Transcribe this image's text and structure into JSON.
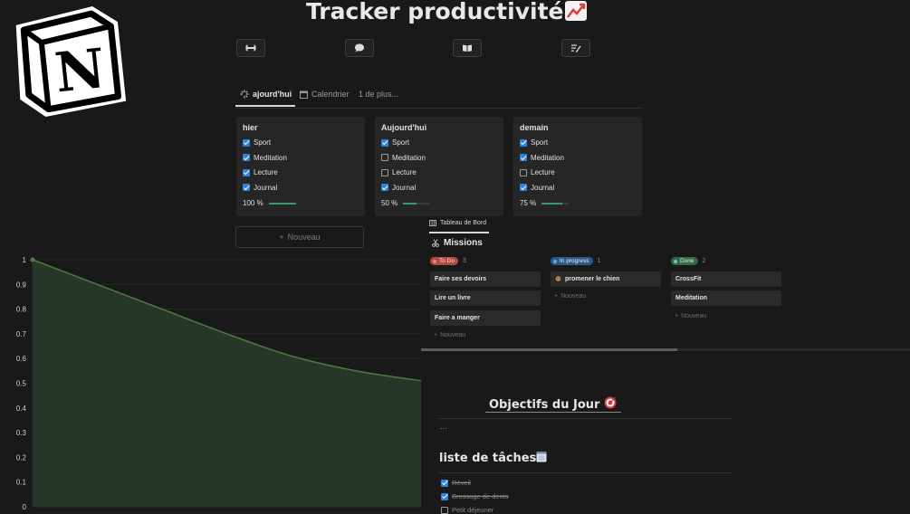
{
  "page": {
    "title": "Tracker productivité",
    "title_emoji": "chart-increasing-icon"
  },
  "toolbar_icons": [
    "dumbbell-icon",
    "speech-bubble-icon",
    "open-book-icon",
    "notepad-icon"
  ],
  "views": {
    "tabs": [
      {
        "label": "ajourd'hui",
        "icon": "sparkle-icon",
        "active": true
      },
      {
        "label": "Calendrier",
        "icon": "calendar-icon",
        "active": false
      },
      {
        "label": "1 de plus...",
        "icon": "",
        "active": false
      }
    ]
  },
  "days": [
    {
      "title": "hier",
      "items": [
        {
          "label": "Sport",
          "checked": true
        },
        {
          "label": "Meditation",
          "checked": true
        },
        {
          "label": "Lecture",
          "checked": true
        },
        {
          "label": "Journal",
          "checked": true
        }
      ],
      "progress_label": "100 %",
      "progress": 1.0
    },
    {
      "title": "Aujourd'hui",
      "items": [
        {
          "label": "Sport",
          "checked": true
        },
        {
          "label": "Meditation",
          "checked": false
        },
        {
          "label": "Lecture",
          "checked": false
        },
        {
          "label": "Journal",
          "checked": true
        }
      ],
      "progress_label": "50 %",
      "progress": 0.5
    },
    {
      "title": "demain",
      "items": [
        {
          "label": "Sport",
          "checked": true
        },
        {
          "label": "Meditation",
          "checked": true
        },
        {
          "label": "Lecture",
          "checked": false
        },
        {
          "label": "Journal",
          "checked": true
        }
      ],
      "progress_label": "75 %",
      "progress": 0.75
    }
  ],
  "new_button": {
    "label": "Nouveau"
  },
  "chart_data": {
    "type": "area",
    "x": [
      0,
      1,
      2,
      3,
      4,
      5,
      6
    ],
    "values": [
      1.0,
      0.9,
      0.8,
      0.7,
      0.61,
      0.55,
      0.51
    ],
    "yticks": [
      "0",
      "0.1",
      "0.2",
      "0.3",
      "0.4",
      "0.5",
      "0.6",
      "0.7",
      "0.8",
      "0.9",
      "1"
    ],
    "ylim": [
      0,
      1
    ],
    "title": "",
    "xlabel": "",
    "ylabel": "",
    "fill_color": "#26372a",
    "line_color": "#4f7a45"
  },
  "kanban": {
    "view_tab": "Tableau de Bord",
    "title": "Missions",
    "title_icon": "scissors-icon",
    "columns": [
      {
        "name": "To Do",
        "count": "3",
        "color": "#b34b45",
        "dot": "#e38a7f",
        "cards": [
          {
            "label": "Faire ses devoirs",
            "icon": ""
          },
          {
            "label": "Lire un livre",
            "icon": ""
          },
          {
            "label": "Faire a manger",
            "icon": ""
          }
        ],
        "new_label": "Nouveau"
      },
      {
        "name": "In progress",
        "count": "1",
        "color": "#2b5a8a",
        "dot": "#6aa8e8",
        "cards": [
          {
            "label": "promener le chien",
            "icon": "dog-icon"
          }
        ],
        "new_label": "Nouveau"
      },
      {
        "name": "Done",
        "count": "2",
        "color": "#2f6a4a",
        "dot": "#6fcf97",
        "cards": [
          {
            "label": "CrossFit",
            "icon": ""
          },
          {
            "label": "Meditation",
            "icon": ""
          }
        ],
        "new_label": "Nouveau"
      }
    ]
  },
  "objectives": {
    "title": "Objectifs du Jour",
    "emoji": "target-icon",
    "placeholder": "..."
  },
  "tasks": {
    "title": "liste de tâches",
    "emoji": "notepad-icon",
    "items": [
      {
        "label": "Réveil",
        "checked": true
      },
      {
        "label": "Brossage de dents",
        "checked": true
      },
      {
        "label": "Petit déjeuner",
        "checked": false
      }
    ]
  }
}
